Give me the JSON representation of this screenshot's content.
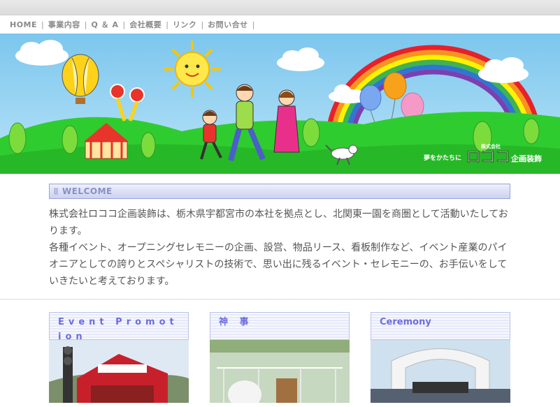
{
  "nav": {
    "items": [
      "HOME",
      "事業内容",
      "Q ＆ A",
      "会社概要",
      "リンク",
      "お問い合せ"
    ],
    "separator": "|"
  },
  "hero": {
    "tagline": "夢をかたちに",
    "company_prefix": "株式会社",
    "logo_text": "ロココ",
    "company_suffix": "企画装飾"
  },
  "welcome": {
    "heading": "WELCOME",
    "paragraph1": "株式会社ロココ企画装飾は、栃木県宇都宮市の本社を拠点とし、北関東一園を商圏として活動いたしております。",
    "paragraph2": "各種イベント、オープニングセレモニーの企画、設営、物品リース、看板制作など、イベント産業のパイオニアとしての誇りとスペシャリストの技術で、思い出に残るイベント・セレモニーの、お手伝いをしていきたいと考えております。"
  },
  "cards": [
    {
      "title": "Event Promotion"
    },
    {
      "title": "神 事"
    },
    {
      "title": "Ceremony"
    }
  ],
  "colors": {
    "accent": "#6d6de0",
    "nav_text": "#8a8a8a",
    "grass": "#33cc33",
    "sky": "#8fd0f0"
  }
}
